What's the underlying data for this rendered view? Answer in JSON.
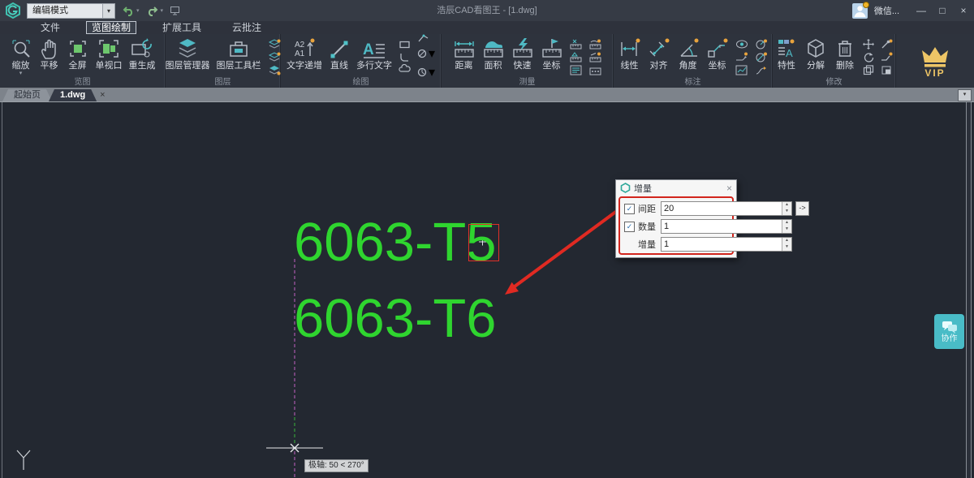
{
  "colors": {
    "highlight_red": "#e02a22",
    "text_green": "#2fd52f",
    "accent_teal": "#4fc1c7",
    "canvas_bg": "#232831"
  },
  "icons": {
    "caret_down": "▾",
    "minimize": "—",
    "maximize": "□",
    "close": "×",
    "check": "✓",
    "spin_up": "▲",
    "spin_down": "▼"
  },
  "titlebar": {
    "mode_dropdown_value": "编辑模式",
    "window_title": "浩辰CAD看图王 - [1.dwg]",
    "wechat_label": "微信..."
  },
  "menubar": {
    "items": [
      {
        "label": "文件"
      },
      {
        "label": "览图绘制"
      },
      {
        "label": "扩展工具"
      },
      {
        "label": "云批注"
      }
    ]
  },
  "ribbon": {
    "groups": [
      {
        "label": "览图",
        "buttons": [
          {
            "label": "缩放"
          },
          {
            "label": "平移"
          },
          {
            "label": "全屏"
          },
          {
            "label": "单视口"
          },
          {
            "label": "重生成"
          }
        ]
      },
      {
        "label": "图层",
        "buttons": [
          {
            "label": "图层管理器"
          },
          {
            "label": "图层工具栏"
          }
        ]
      },
      {
        "label": "绘图",
        "buttons": [
          {
            "label": "文字递增"
          },
          {
            "label": "直线"
          },
          {
            "label": "多行文字"
          }
        ]
      },
      {
        "label": "测量",
        "buttons": [
          {
            "label": "距离"
          },
          {
            "label": "面积"
          },
          {
            "label": "快速"
          },
          {
            "label": "坐标"
          }
        ]
      },
      {
        "label": "标注",
        "buttons": [
          {
            "label": "线性"
          },
          {
            "label": "对齐"
          },
          {
            "label": "角度"
          },
          {
            "label": "坐标"
          }
        ]
      },
      {
        "label": "修改",
        "buttons": [
          {
            "label": "特性"
          },
          {
            "label": "分解"
          },
          {
            "label": "删除"
          }
        ]
      }
    ],
    "vip_label": "VIP"
  },
  "tabbar": {
    "tabs": [
      {
        "label": "起始页"
      },
      {
        "label": "1.dwg"
      }
    ]
  },
  "canvas": {
    "text_top": "6063-T5",
    "text_bottom": "6063-T6",
    "polar_tooltip": "极轴: 50 < 270°"
  },
  "dialog": {
    "title": "增量",
    "rows": [
      {
        "label": "间距",
        "value": "20",
        "checked": true,
        "apply_button": "->"
      },
      {
        "label": "数量",
        "value": "1",
        "checked": true
      },
      {
        "label": "增量",
        "value": "1",
        "checked": false
      }
    ]
  },
  "collab_button": {
    "label": "协作"
  }
}
